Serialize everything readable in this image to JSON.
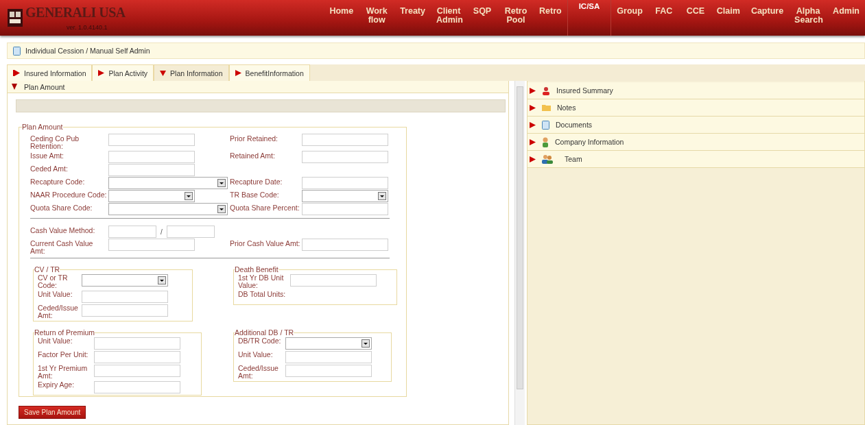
{
  "header": {
    "logo_title": "GENERALI USA",
    "version": "ver. 1.0.4140.1",
    "nav": [
      {
        "label": "Home",
        "selected": false
      },
      {
        "label": "Work flow",
        "selected": false
      },
      {
        "label": "Treaty",
        "selected": false
      },
      {
        "label": "Client Admin",
        "selected": false
      },
      {
        "label": "SQP",
        "selected": false
      },
      {
        "label": "Retro Pool",
        "selected": false
      },
      {
        "label": "Retro",
        "selected": false
      },
      {
        "label": "IC/SA",
        "selected": true
      },
      {
        "label": "Group",
        "selected": false
      },
      {
        "label": "FAC",
        "selected": false
      },
      {
        "label": "CCE",
        "selected": false
      },
      {
        "label": "Claim",
        "selected": false
      },
      {
        "label": "Capture",
        "selected": false
      },
      {
        "label": "Alpha Search",
        "selected": false
      },
      {
        "label": "Admin",
        "selected": false
      }
    ]
  },
  "breadcrumb": "Individual Cession / Manual Self Admin",
  "tabs": [
    {
      "label": "Insured Information",
      "selected": false,
      "kind": "flag"
    },
    {
      "label": "Plan Activity",
      "selected": false,
      "kind": "arrow"
    },
    {
      "label": "Plan Information",
      "selected": true,
      "kind": "arrow"
    },
    {
      "label": "BenefitInformation",
      "selected": false,
      "kind": "arrow"
    }
  ],
  "section": {
    "title": "Plan Amount",
    "expanded": true,
    "fieldset": {
      "legend": "Plan Amount",
      "groups": [
        {
          "rows": [
            {
              "left": {
                "label": "Ceding Co Pub Retention:",
                "kind": "text"
              },
              "right": {
                "label": "Prior Retained:",
                "kind": "text"
              }
            },
            {
              "left": {
                "label": "Issue Amt:",
                "kind": "text"
              },
              "right": {
                "label": "Retained Amt:",
                "kind": "text"
              }
            },
            {
              "left": {
                "label": "Ceded Amt:",
                "kind": "text"
              }
            },
            {
              "left": {
                "label": "Recapture Code:",
                "kind": "select-wide"
              },
              "right": {
                "label": "Recapture Date:",
                "kind": "text"
              }
            },
            {
              "left": {
                "label": "NAAR Procedure Code:",
                "kind": "select"
              },
              "right": {
                "label": "TR Base Code:",
                "kind": "select"
              }
            },
            {
              "left": {
                "label": "Quota Share Code:",
                "kind": "select-wide"
              },
              "right": {
                "label": "Quota Share Percent:",
                "kind": "text"
              }
            }
          ]
        },
        {
          "rows": [
            {
              "left": {
                "label": "Cash Value Method:",
                "kind": "split",
                "separator": "/"
              }
            },
            {
              "left": {
                "label": "Current Cash Value Amt:",
                "kind": "text"
              },
              "right": {
                "label": "Prior Cash Value Amt:",
                "kind": "text"
              }
            }
          ]
        }
      ],
      "subsections": [
        {
          "legend": "CV / TR",
          "fields": [
            {
              "label": "CV or TR Code:",
              "kind": "select"
            },
            {
              "label": "Unit Value:",
              "kind": "text"
            },
            {
              "label": "Ceded/Issue Amt:",
              "kind": "text"
            }
          ]
        },
        {
          "legend": "Death Benefit",
          "fields": [
            {
              "label": "1st Yr DB Unit Value:",
              "kind": "text"
            },
            {
              "label": "DB Total Units:",
              "kind": "label"
            }
          ]
        },
        {
          "legend": "Return of Premium",
          "fields": [
            {
              "label": "Unit Value:",
              "kind": "text"
            },
            {
              "label": "Factor Per Unit:",
              "kind": "text"
            },
            {
              "label": "1st Yr Premium Amt:",
              "kind": "text"
            },
            {
              "label": "Expiry Age:",
              "kind": "text"
            }
          ]
        },
        {
          "legend": "Additional DB / TR",
          "fields": [
            {
              "label": "DB/TR Code:",
              "kind": "select"
            },
            {
              "label": "Unit Value:",
              "kind": "text"
            },
            {
              "label": "Ceded/Issue Amt:",
              "kind": "text"
            }
          ]
        }
      ]
    },
    "save_button": "Save Plan Amount"
  },
  "side_panels": [
    {
      "label": "Insured Summary",
      "kind": "person",
      "expanded": false
    },
    {
      "label": "Notes",
      "kind": "folder",
      "expanded": false
    },
    {
      "label": "Documents",
      "kind": "document",
      "expanded": false
    },
    {
      "label": "Company Information",
      "kind": "contact",
      "expanded": false
    },
    {
      "label": "Team",
      "kind": "team",
      "expanded": false
    }
  ]
}
